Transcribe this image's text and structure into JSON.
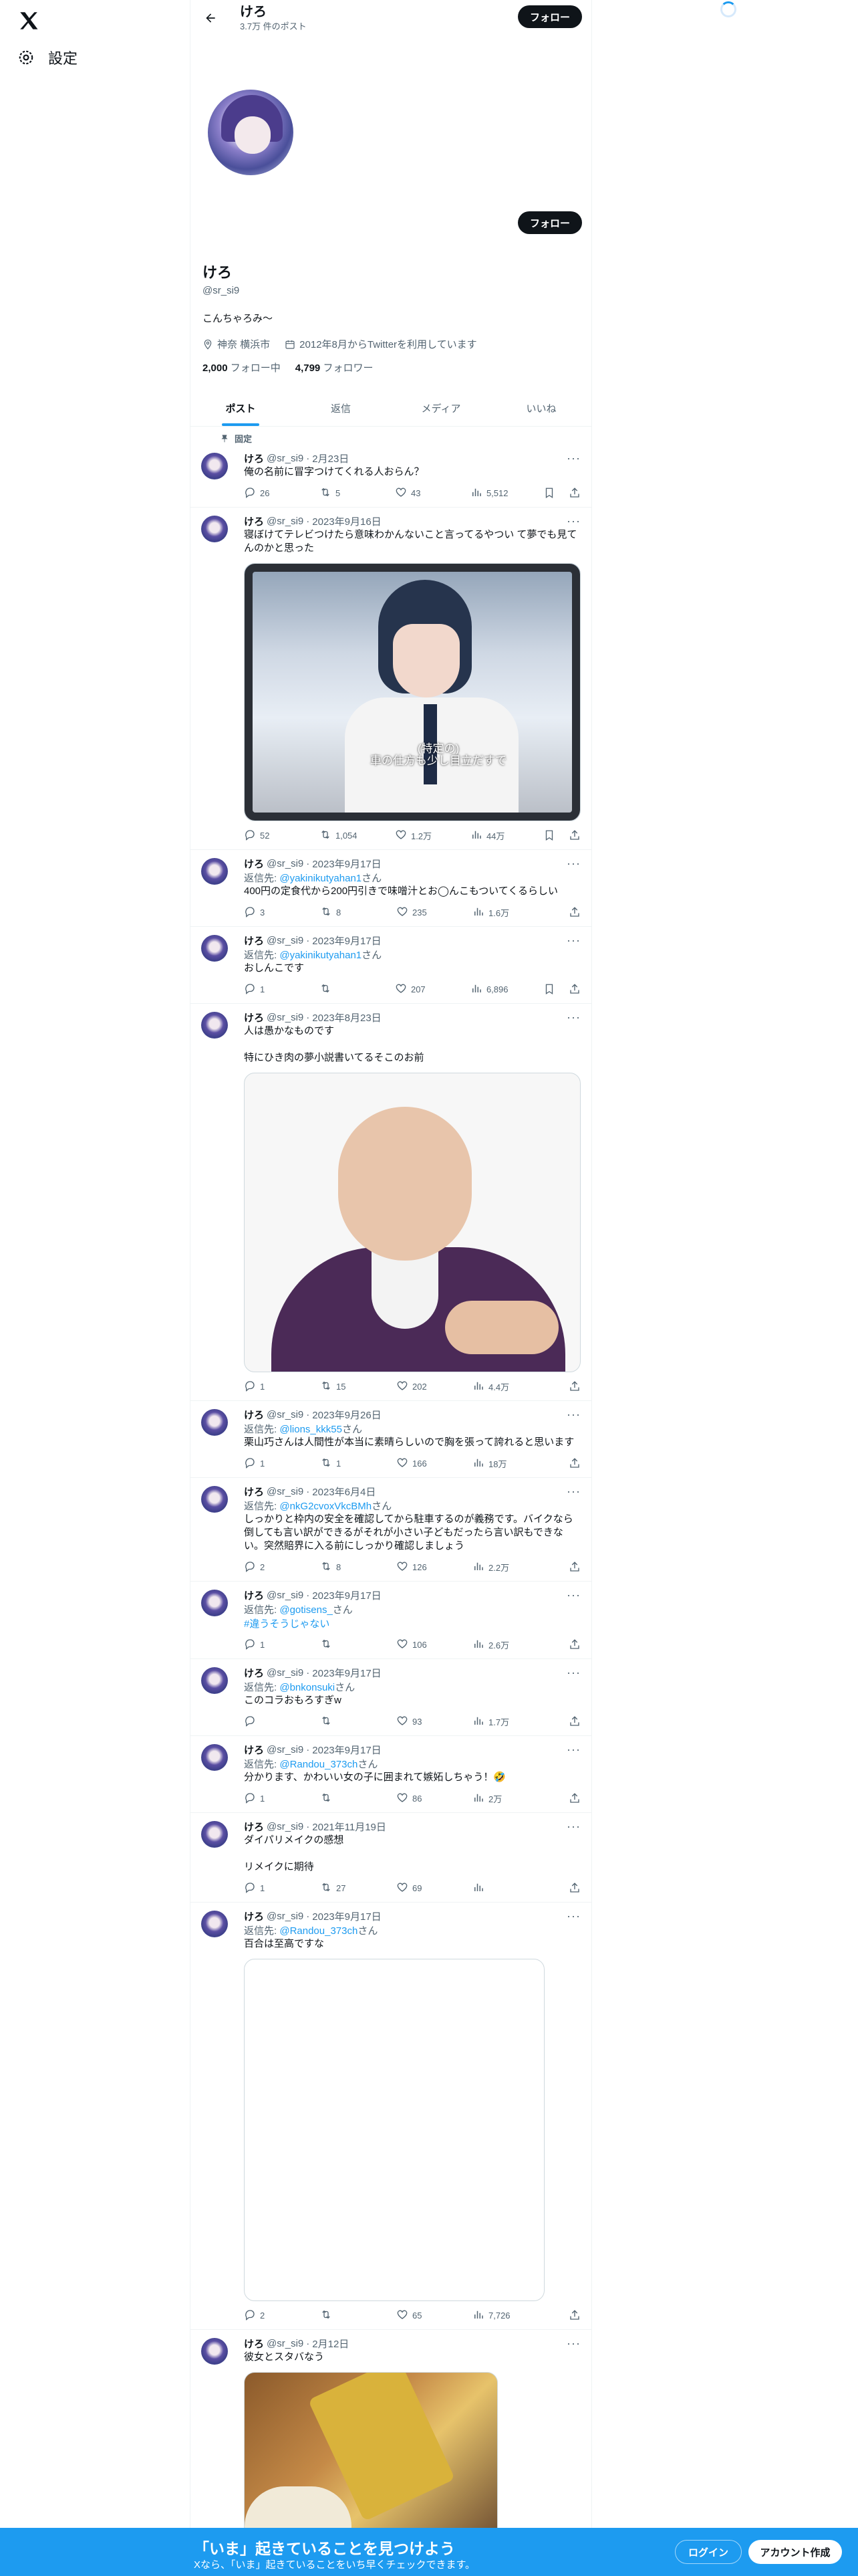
{
  "nav": {
    "settings_label": "設定"
  },
  "header": {
    "name": "けろ",
    "post_count": "3.7万 件のポスト",
    "follow_label": "フォロー"
  },
  "profile": {
    "name": "けろ",
    "handle": "@sr_si9",
    "bio": "こんちゃろみ〜",
    "location": "神奈 横浜市",
    "joined": "2012年8月からTwitterを利用しています",
    "following_count": "2,000",
    "following_label": "フォロー中",
    "followers_count": "4,799",
    "followers_label": "フォロワー",
    "follow_label": "フォロー"
  },
  "tabs": [
    "ポスト",
    "返信",
    "メディア",
    "いいね"
  ],
  "pinned_label": "固定",
  "tweets": [
    {
      "name": "けろ",
      "handle": "@sr_si9",
      "date": "2月23日",
      "reply_to": "",
      "text": "俺の名前に冒字つけてくれる人おらん？",
      "replies": "26",
      "retweets": "5",
      "likes": "43",
      "views": "5,512"
    },
    {
      "name": "けろ",
      "handle": "@sr_si9",
      "date": "2023年9月16日",
      "reply_to": "",
      "text": "寝ぼけてテレビつけたら意味わかんないこと言ってるやつい て夢でも見てんのかと思った",
      "replies": "52",
      "retweets": "1,054",
      "likes": "1.2万",
      "views": "44万",
      "subtitle": "(特定の)\n車の仕方も少し目立だすで"
    },
    {
      "name": "けろ",
      "handle": "@sr_si9",
      "date": "2023年9月17日",
      "reply_to": "@yakinikutyahan1",
      "text": "400円の定食代から200円引きで味噌汁とお◯んこもついてくるらしい",
      "replies": "3",
      "retweets": "8",
      "likes": "235",
      "views": "1.6万"
    },
    {
      "name": "けろ",
      "handle": "@sr_si9",
      "date": "2023年9月17日",
      "reply_to": "@yakinikutyahan1",
      "text": "おしんこです",
      "replies": "1",
      "retweets": "",
      "likes": "207",
      "views": "6,896"
    },
    {
      "name": "けろ",
      "handle": "@sr_si9",
      "date": "2023年8月23日",
      "reply_to": "",
      "text": "人は愚かなものです\n\n特にひき肉の夢小説書いてるそこのお前",
      "replies": "1",
      "retweets": "15",
      "likes": "202",
      "views": "4.4万"
    },
    {
      "name": "けろ",
      "handle": "@sr_si9",
      "date": "2023年9月26日",
      "reply_to": "@lions_kkk55",
      "text": "栗山巧さんは人間性が本当に素晴らしいので胸を張って誇れると思います",
      "replies": "1",
      "retweets": "1",
      "likes": "166",
      "views": "18万"
    },
    {
      "name": "けろ",
      "handle": "@sr_si9",
      "date": "2023年6月4日",
      "reply_to": "@nkG2cvoxVkcBMh",
      "text": "しっかりと枠内の安全を確認してから駐車するのが義務です。バイクなら倒しても言い訳ができるがそれが小さい子どもだったら言い訳もできない。突然賠界に入る前にしっかり確認しましょう",
      "replies": "2",
      "retweets": "8",
      "likes": "126",
      "views": "2.2万"
    },
    {
      "name": "けろ",
      "handle": "@sr_si9",
      "date": "2023年9月17日",
      "reply_to": "@gotisens_",
      "text": "",
      "hashtag": "#違うそうじゃない",
      "replies": "1",
      "retweets": "",
      "likes": "106",
      "views": "2.6万"
    },
    {
      "name": "けろ",
      "handle": "@sr_si9",
      "date": "2023年9月17日",
      "reply_to": "@bnkonsuki",
      "text": "このコラおもろすぎw",
      "replies": "",
      "retweets": "",
      "likes": "93",
      "views": "1.7万"
    },
    {
      "name": "けろ",
      "handle": "@sr_si9",
      "date": "2023年9月17日",
      "reply_to": "@Randou_373ch",
      "text": "分かります、かわいい女の子に囲まれて嫉妬しちゃう！🤣",
      "replies": "1",
      "retweets": "",
      "likes": "86",
      "views": "2万"
    },
    {
      "name": "けろ",
      "handle": "@sr_si9",
      "date": "2021年11月19日",
      "reply_to": "",
      "text": "ダイパリメイクの感想\n\nリメイクに期待",
      "replies": "1",
      "retweets": "27",
      "likes": "69",
      "views": ""
    },
    {
      "name": "けろ",
      "handle": "@sr_si9",
      "date": "2023年9月17日",
      "reply_to": "@Randou_373ch",
      "text": "百合は至高ですな",
      "replies": "2",
      "retweets": "",
      "likes": "65",
      "views": "7,726"
    },
    {
      "name": "けろ",
      "handle": "@sr_si9",
      "date": "2月12日",
      "reply_to": "",
      "text": "彼女とスタバなう"
    }
  ],
  "reply_prefix": "返信先: ",
  "reply_suffix": "さん",
  "bottom": {
    "title": "「いま」起きていることを見つけよう",
    "subtitle": "Xなら、「いま」起きていることをいち早くチェックできます。",
    "login": "ログイン",
    "signup": "アカウント作成"
  }
}
